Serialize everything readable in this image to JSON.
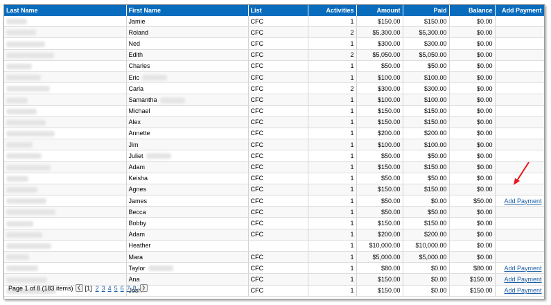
{
  "columns": {
    "last_name": "Last Name",
    "first_name": "First Name",
    "list": "List",
    "activities": "Activities",
    "amount": "Amount",
    "paid": "Paid",
    "balance": "Balance",
    "add_payment": "Add Payment"
  },
  "rows": [
    {
      "first": "Jamie",
      "list": "CFC",
      "activities": "1",
      "amount": "$150.00",
      "paid": "$150.00",
      "balance": "$0.00",
      "add": ""
    },
    {
      "first": "Roland",
      "list": "CFC",
      "activities": "2",
      "amount": "$5,300.00",
      "paid": "$5,300.00",
      "balance": "$0.00",
      "add": ""
    },
    {
      "first": "Ned",
      "list": "CFC",
      "activities": "1",
      "amount": "$300.00",
      "paid": "$300.00",
      "balance": "$0.00",
      "add": ""
    },
    {
      "first": "Edith",
      "list": "CFC",
      "activities": "2",
      "amount": "$5,050.00",
      "paid": "$5,050.00",
      "balance": "$0.00",
      "add": ""
    },
    {
      "first": "Charles",
      "list": "CFC",
      "activities": "1",
      "amount": "$50.00",
      "paid": "$50.00",
      "balance": "$0.00",
      "add": ""
    },
    {
      "first": "Eric",
      "list": "CFC",
      "activities": "1",
      "amount": "$100.00",
      "paid": "$100.00",
      "balance": "$0.00",
      "add": "",
      "redacted": true
    },
    {
      "first": "Carla",
      "list": "CFC",
      "activities": "2",
      "amount": "$300.00",
      "paid": "$300.00",
      "balance": "$0.00",
      "add": ""
    },
    {
      "first": "Samantha",
      "list": "CFC",
      "activities": "1",
      "amount": "$100.00",
      "paid": "$100.00",
      "balance": "$0.00",
      "add": "",
      "redacted": true
    },
    {
      "first": "Michael",
      "list": "CFC",
      "activities": "1",
      "amount": "$150.00",
      "paid": "$150.00",
      "balance": "$0.00",
      "add": ""
    },
    {
      "first": "Alex",
      "list": "CFC",
      "activities": "1",
      "amount": "$150.00",
      "paid": "$150.00",
      "balance": "$0.00",
      "add": ""
    },
    {
      "first": "Annette",
      "list": "CFC",
      "activities": "1",
      "amount": "$200.00",
      "paid": "$200.00",
      "balance": "$0.00",
      "add": ""
    },
    {
      "first": "Jim",
      "list": "CFC",
      "activities": "1",
      "amount": "$100.00",
      "paid": "$100.00",
      "balance": "$0.00",
      "add": ""
    },
    {
      "first": "Juliet",
      "list": "CFC",
      "activities": "1",
      "amount": "$50.00",
      "paid": "$50.00",
      "balance": "$0.00",
      "add": "",
      "redacted": true
    },
    {
      "first": "Adam",
      "list": "CFC",
      "activities": "1",
      "amount": "$150.00",
      "paid": "$150.00",
      "balance": "$0.00",
      "add": ""
    },
    {
      "first": "Keisha",
      "list": "CFC",
      "activities": "1",
      "amount": "$50.00",
      "paid": "$50.00",
      "balance": "$0.00",
      "add": ""
    },
    {
      "first": "Agnes",
      "list": "CFC",
      "activities": "1",
      "amount": "$150.00",
      "paid": "$150.00",
      "balance": "$0.00",
      "add": ""
    },
    {
      "first": "James",
      "list": "CFC",
      "activities": "1",
      "amount": "$50.00",
      "paid": "$0.00",
      "balance": "$50.00",
      "add": "Add Payment"
    },
    {
      "first": "Becca",
      "list": "CFC",
      "activities": "1",
      "amount": "$50.00",
      "paid": "$50.00",
      "balance": "$0.00",
      "add": ""
    },
    {
      "first": "Bobby",
      "list": "CFC",
      "activities": "1",
      "amount": "$150.00",
      "paid": "$150.00",
      "balance": "$0.00",
      "add": ""
    },
    {
      "first": "Adam",
      "list": "CFC",
      "activities": "1",
      "amount": "$200.00",
      "paid": "$200.00",
      "balance": "$0.00",
      "add": ""
    },
    {
      "first": "Heather",
      "list": "",
      "activities": "1",
      "amount": "$10,000.00",
      "paid": "$10,000.00",
      "balance": "$0.00",
      "add": ""
    },
    {
      "first": "Mara",
      "list": "CFC",
      "activities": "1",
      "amount": "$5,000.00",
      "paid": "$5,000.00",
      "balance": "$0.00",
      "add": ""
    },
    {
      "first": "Taylor",
      "list": "CFC",
      "activities": "1",
      "amount": "$80.00",
      "paid": "$0.00",
      "balance": "$80.00",
      "add": "Add Payment",
      "redacted": true
    },
    {
      "first": "Ana",
      "list": "CFC",
      "activities": "1",
      "amount": "$150.00",
      "paid": "$0.00",
      "balance": "$150.00",
      "add": "Add Payment"
    },
    {
      "first": "Josh",
      "list": "CFC",
      "activities": "1",
      "amount": "$150.00",
      "paid": "$0.00",
      "balance": "$150.00",
      "add": "Add Payment"
    }
  ],
  "pager": {
    "info": "Page 1 of 8 (183 items)",
    "prev_icon": "chevron-left-icon",
    "current": "[1]",
    "pages": [
      "2",
      "3",
      "4",
      "5",
      "6",
      "7",
      "8"
    ],
    "next_icon": "chevron-right-icon"
  },
  "annotation": {
    "icon": "red-arrow-icon",
    "color": "#e8141b"
  },
  "colors": {
    "header": "#0a6cbd",
    "link": "#1d5fa8"
  }
}
